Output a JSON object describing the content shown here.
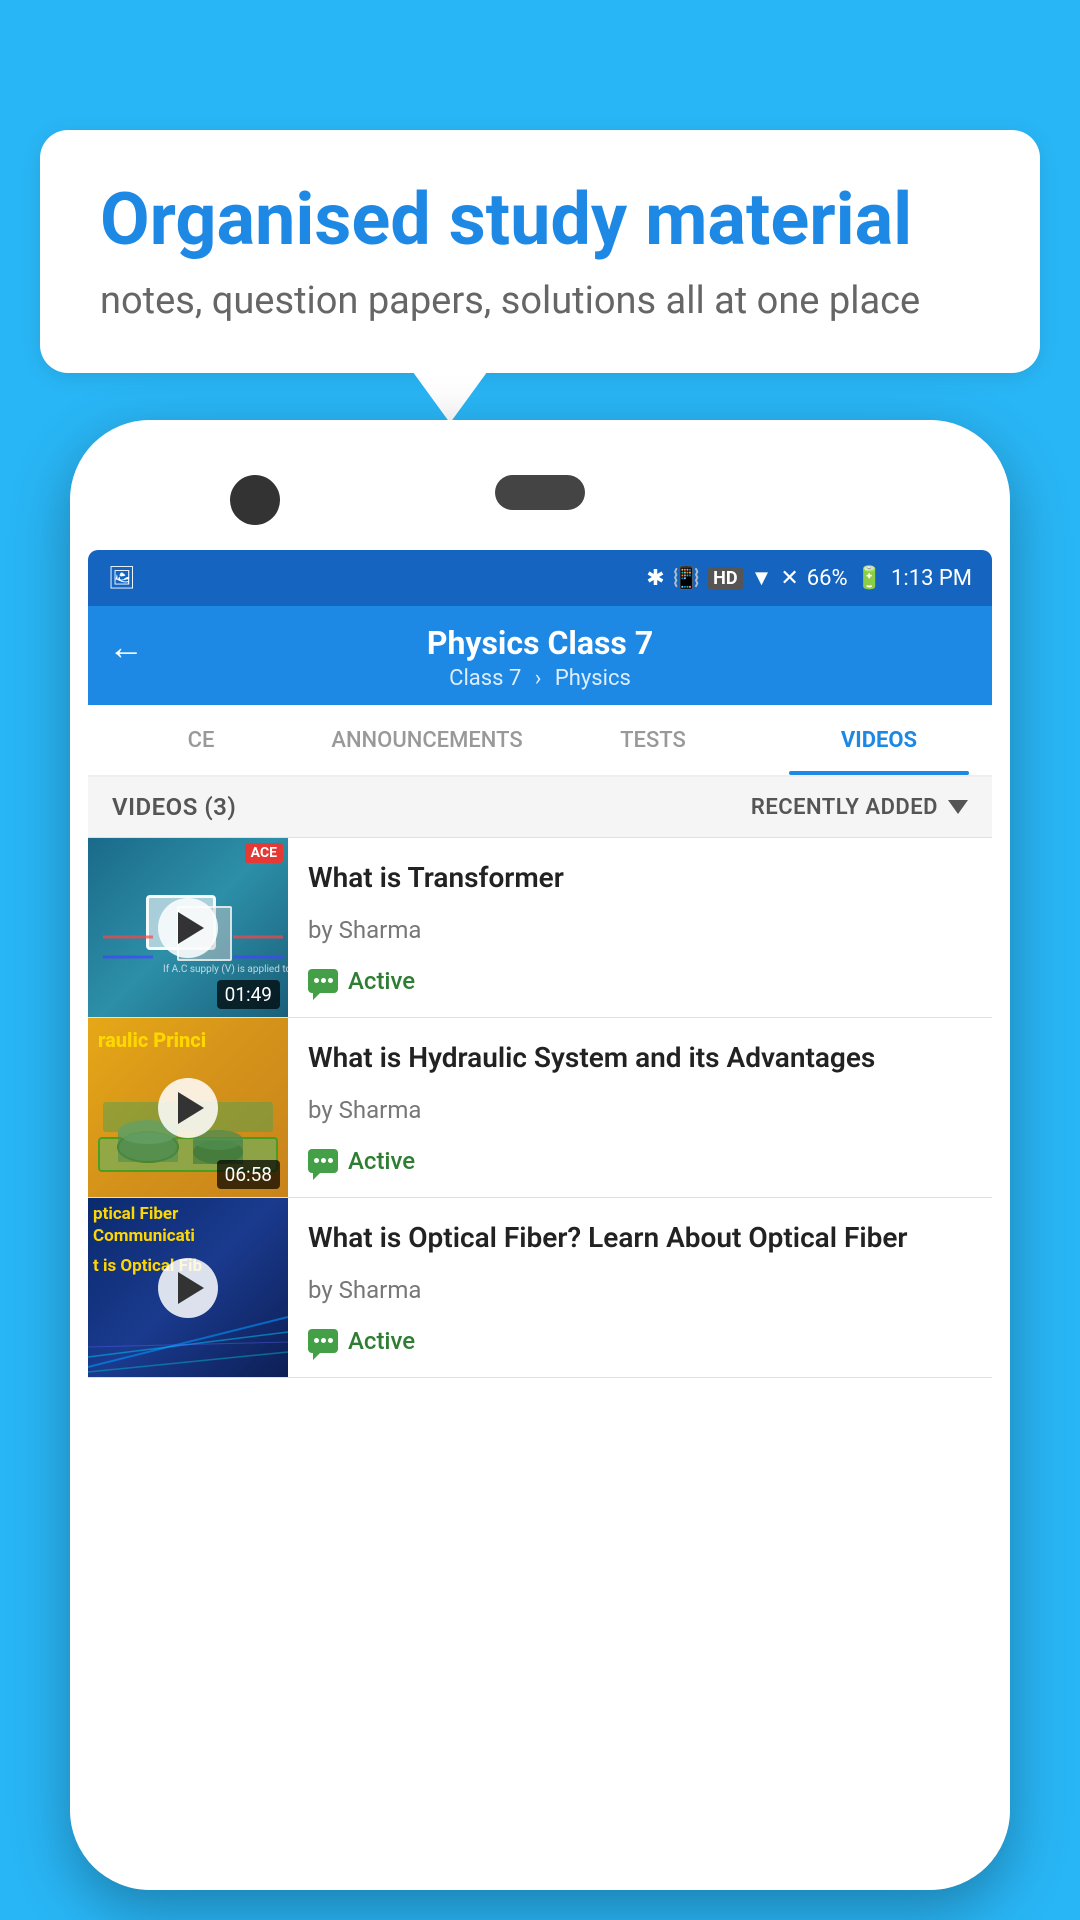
{
  "background_color": "#29b6f6",
  "speech_bubble": {
    "title": "Organised study material",
    "subtitle": "notes, question papers, solutions all at one place"
  },
  "status_bar": {
    "time": "1:13 PM",
    "battery": "66%",
    "signal_icons": "🔵 📳 HD ▼ ✖ 📶"
  },
  "header": {
    "title": "Physics Class 7",
    "breadcrumb_class": "Class 7",
    "breadcrumb_subject": "Physics",
    "back_arrow": "←"
  },
  "tabs": [
    {
      "id": "ce",
      "label": "CE",
      "active": false
    },
    {
      "id": "announcements",
      "label": "ANNOUNCEMENTS",
      "active": false
    },
    {
      "id": "tests",
      "label": "TESTS",
      "active": false
    },
    {
      "id": "videos",
      "label": "VIDEOS",
      "active": true
    }
  ],
  "list_header": {
    "count_label": "VIDEOS (3)",
    "sort_label": "RECENTLY ADDED"
  },
  "videos": [
    {
      "id": 1,
      "title": "What is  Transformer",
      "author": "by Sharma",
      "status": "Active",
      "duration": "01:49",
      "thumbnail_label": "ACE",
      "thumbnail_type": "transformer"
    },
    {
      "id": 2,
      "title": "What is Hydraulic System and its Advantages",
      "author": "by Sharma",
      "status": "Active",
      "duration": "06:58",
      "thumbnail_text": "raulic Princi",
      "thumbnail_type": "hydraulic"
    },
    {
      "id": 3,
      "title": "What is Optical Fiber? Learn About Optical Fiber",
      "author": "by Sharma",
      "status": "Active",
      "duration": "",
      "thumbnail_text1": "ptical Fiber Communicati",
      "thumbnail_text2": "t is Optical Fib",
      "thumbnail_type": "optical"
    }
  ]
}
